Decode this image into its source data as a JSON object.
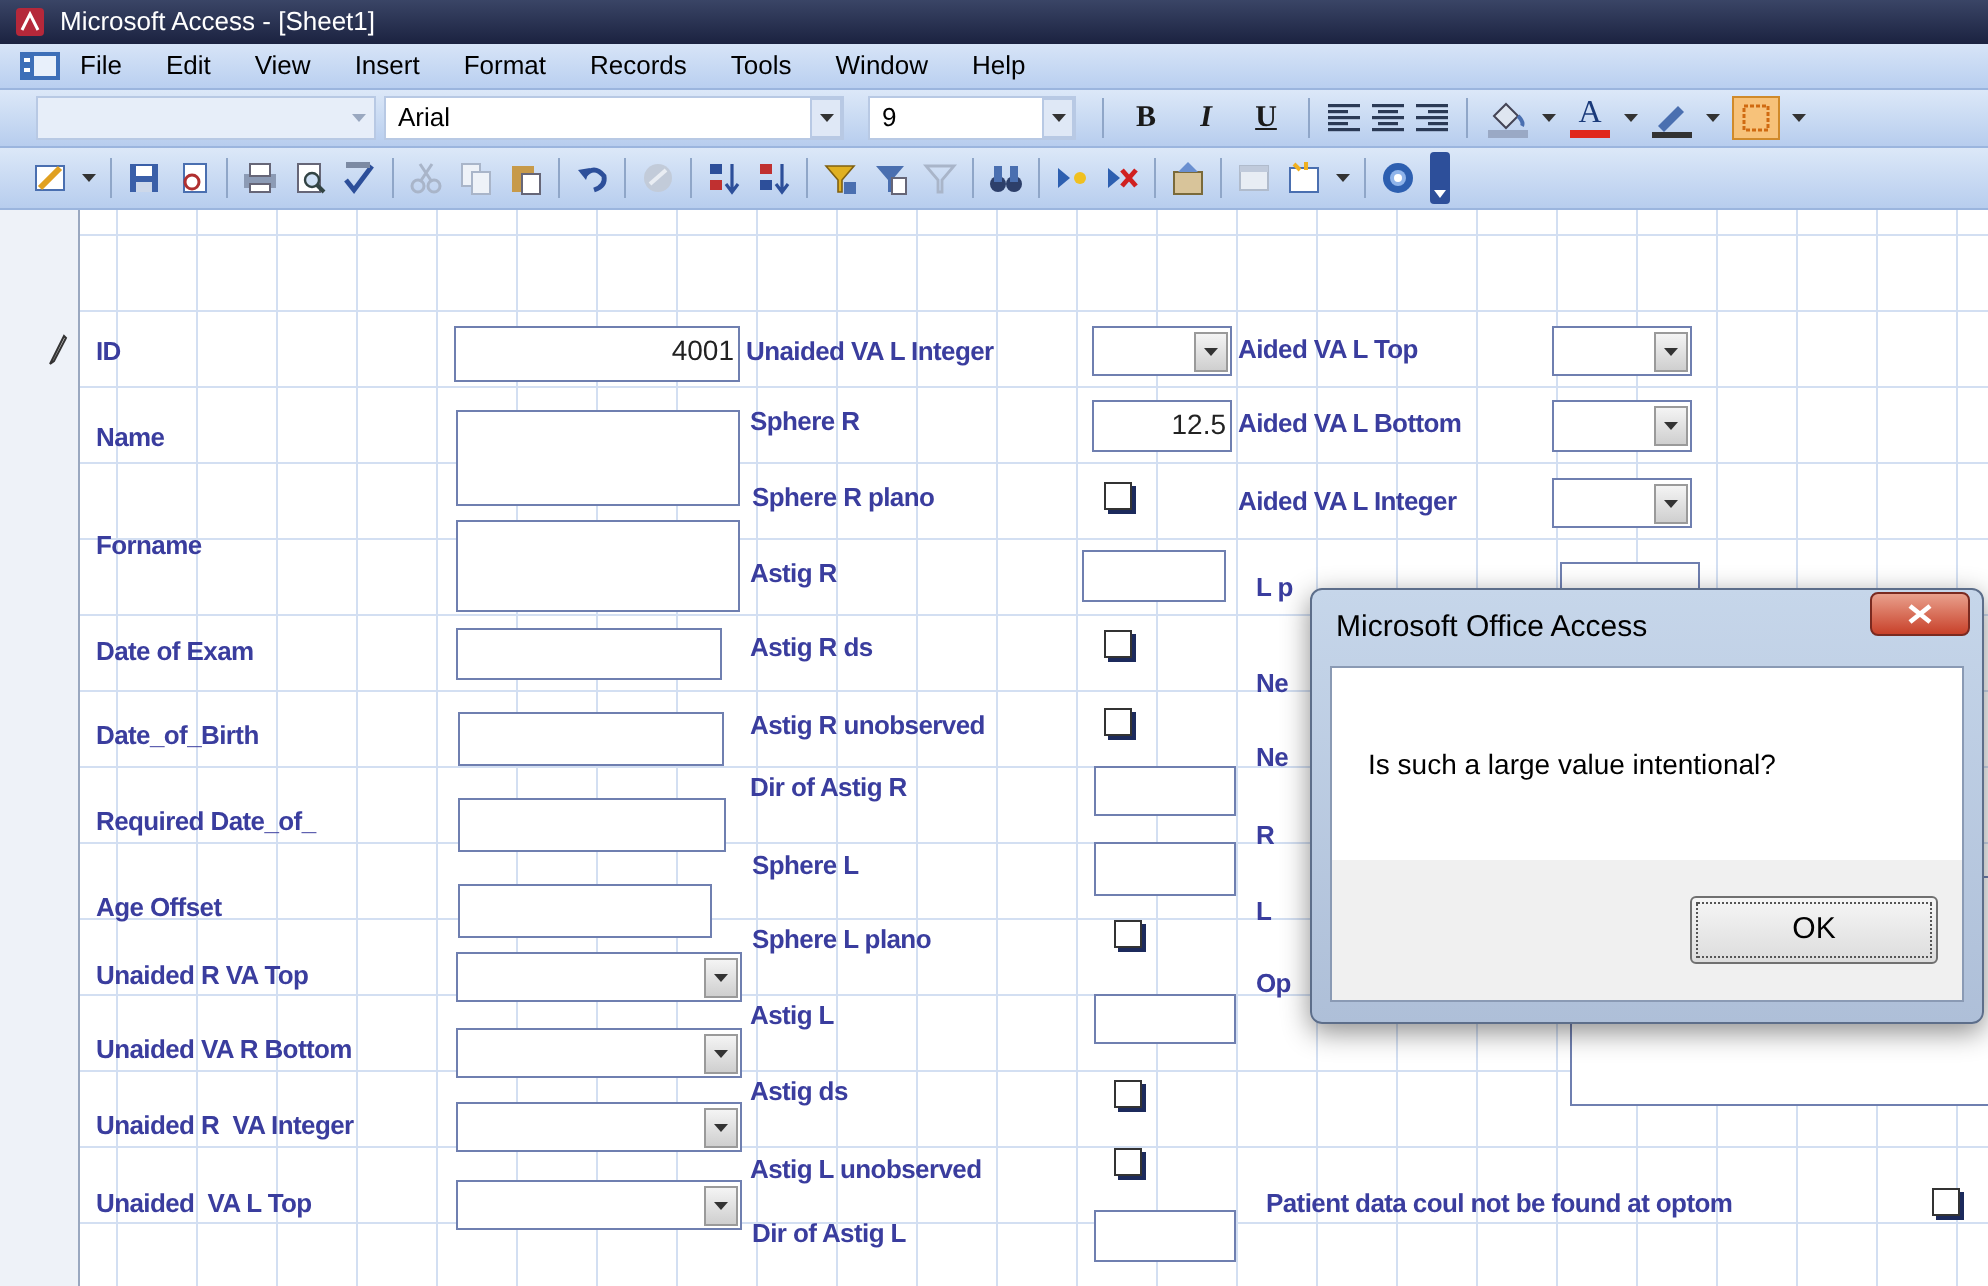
{
  "window": {
    "title": "Microsoft Access - [Sheet1]"
  },
  "menu": [
    "File",
    "Edit",
    "View",
    "Insert",
    "Format",
    "Records",
    "Tools",
    "Window",
    "Help"
  ],
  "formatting_toolbar": {
    "font": "Arial",
    "font_size": "9",
    "style_buttons": [
      "B",
      "I",
      "U"
    ],
    "font_color_glyph": "A"
  },
  "form": {
    "controls": [
      {
        "kind": "textbox",
        "label": "ID",
        "value": "4001"
      },
      {
        "kind": "textbox",
        "label": "Name"
      },
      {
        "kind": "textbox",
        "label": "Forname"
      },
      {
        "kind": "textbox",
        "label": "Date of Exam"
      },
      {
        "kind": "textbox",
        "label": "Date_of_Birth"
      },
      {
        "kind": "textbox",
        "label": "Required Date_of_"
      },
      {
        "kind": "textbox",
        "label": "Age Offset"
      },
      {
        "kind": "combo",
        "label": "Unaided R VA Top"
      },
      {
        "kind": "combo",
        "label": "Unaided VA R Bottom"
      },
      {
        "kind": "combo",
        "label": "Unaided R  VA Integer"
      },
      {
        "kind": "combo",
        "label": "Unaided  VA L Top"
      },
      {
        "kind": "combo",
        "label": "Unaided VA L Integer"
      },
      {
        "kind": "textbox",
        "label": "Sphere R",
        "value": "12.5"
      },
      {
        "kind": "checkbox",
        "label": "Sphere R plano",
        "checked": false
      },
      {
        "kind": "textbox",
        "label": "Astig R"
      },
      {
        "kind": "checkbox",
        "label": "Astig R ds",
        "checked": false
      },
      {
        "kind": "checkbox",
        "label": "Astig R unobserved",
        "checked": false
      },
      {
        "kind": "textbox",
        "label": "Dir of Astig R"
      },
      {
        "kind": "textbox",
        "label": "Sphere L"
      },
      {
        "kind": "checkbox",
        "label": "Sphere L plano",
        "checked": false
      },
      {
        "kind": "textbox",
        "label": "Astig L"
      },
      {
        "kind": "checkbox",
        "label": "Astig ds",
        "checked": false
      },
      {
        "kind": "checkbox",
        "label": "Astig L unobserved",
        "checked": false
      },
      {
        "kind": "textbox",
        "label": "Dir of Astig L"
      },
      {
        "kind": "combo",
        "label": "Aided VA L Top"
      },
      {
        "kind": "combo",
        "label": "Aided VA L Bottom"
      },
      {
        "kind": "combo",
        "label": "Aided VA L Integer"
      },
      {
        "kind": "label",
        "label": "L p"
      },
      {
        "kind": "label",
        "label": "Ne"
      },
      {
        "kind": "label",
        "label": "Ne"
      },
      {
        "kind": "label",
        "label": "R"
      },
      {
        "kind": "label",
        "label": "L"
      },
      {
        "kind": "label",
        "label": "Op"
      },
      {
        "kind": "textbox"
      },
      {
        "kind": "textbox"
      },
      {
        "kind": "checkbox",
        "label": "Patient data coul not be found at optom",
        "checked": false
      }
    ]
  },
  "dialog": {
    "title": "Microsoft Office Access",
    "message": "Is such a large value intentional?",
    "button": "OK"
  }
}
